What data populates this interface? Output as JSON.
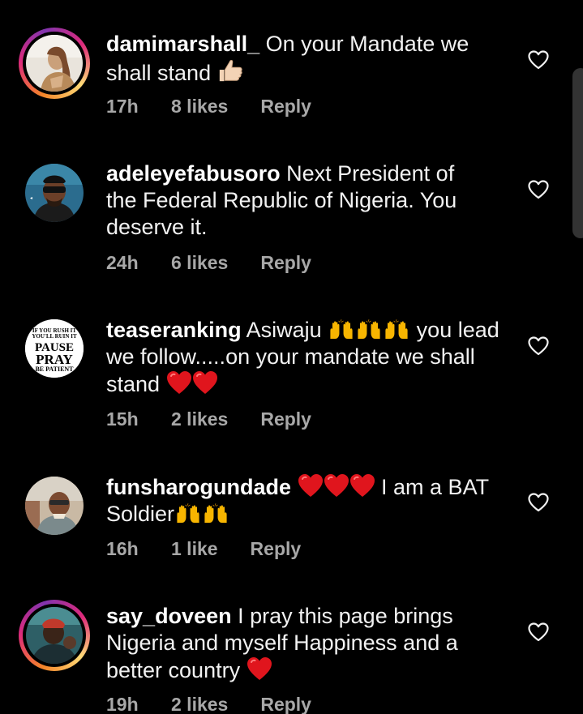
{
  "comments": [
    {
      "username": "damimarshall_",
      "text_1": "On your Mandate we",
      "text_2": "shall stand",
      "time": "17h",
      "likes": "8 likes",
      "reply": "Reply",
      "story_ring": true,
      "emoji": [
        "thumbs-up-icon"
      ]
    },
    {
      "username": "adeleyefabusoro",
      "text_1": "Next President of",
      "text_2": "the Federal Republic of Nigeria. You",
      "text_3": "deserve it.",
      "time": "24h",
      "likes": "6 likes",
      "reply": "Reply",
      "story_ring": false
    },
    {
      "username": "teaseranking",
      "text_1": "Asiwaju",
      "text_1b": "you lead",
      "text_2": "we follow.....on your mandate we shall",
      "text_3": "stand",
      "time": "15h",
      "likes": "2 likes",
      "reply": "Reply",
      "story_ring": false,
      "avatar_text": [
        "IF YOU RUSH IT",
        "YOU'LL RUIN IT",
        "PAUSE",
        "PRAY",
        "BE PATIENT"
      ]
    },
    {
      "username": "funsharogundade",
      "text_1": "I am a BAT",
      "text_2": "Soldier",
      "time": "16h",
      "likes": "1 like",
      "reply": "Reply",
      "story_ring": false
    },
    {
      "username": "say_doveen",
      "text_1": "I pray this page brings",
      "text_2": "Nigeria and myself Happiness and a",
      "text_3": "better country",
      "time": "19h",
      "likes": "2 likes",
      "reply": "Reply",
      "story_ring": true
    }
  ],
  "colors": {
    "background": "#000000",
    "text": "#f2f2f2",
    "meta": "#a8a8a8",
    "heart_emoji": "#e0151d",
    "raised_hands": "#f7b500"
  }
}
